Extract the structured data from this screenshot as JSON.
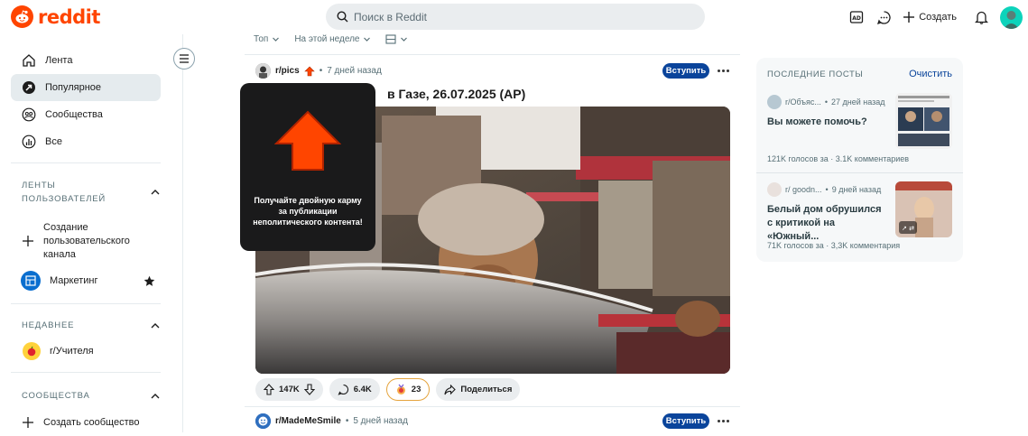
{
  "brand": {
    "name": "reddit",
    "color": "#ff4500"
  },
  "search": {
    "placeholder": "Поиск в Reddit"
  },
  "header": {
    "create_label": "Создать",
    "icons": [
      "ad-icon",
      "chat-icon",
      "plus-icon",
      "bell-icon",
      "avatar"
    ]
  },
  "sidebar": {
    "nav": [
      {
        "label": "Лента",
        "icon": "home-icon"
      },
      {
        "label": "Популярное",
        "icon": "popular-icon",
        "active": true
      },
      {
        "label": "Сообщества",
        "icon": "communities-icon"
      },
      {
        "label": "Все",
        "icon": "all-icon"
      }
    ],
    "custom_feeds": {
      "heading_line1": "ЛЕНТЫ",
      "heading_line2": "ПОЛЬЗОВАТЕЛЕЙ",
      "create_line1": "Создание",
      "create_line2": "пользовательского",
      "create_line3": "канала",
      "marketing": "Маркетинг"
    },
    "recent": {
      "heading": "НЕДАВНЕЕ",
      "item": "r/Учителя"
    },
    "communities": {
      "heading": "СООБЩЕСТВА",
      "create": "Создать сообщество"
    }
  },
  "sort": {
    "sort_label": "Топ",
    "range_label": "На этой неделе"
  },
  "post": {
    "subreddit": "r/pics",
    "time": "7 дней назад",
    "join_label": "Вступить",
    "title_visible": "в Газе, 26.07.2025 (AP)",
    "votes": "147K",
    "comments": "6.4K",
    "awards": "23",
    "share_label": "Поделиться"
  },
  "tooltip": {
    "text": "Получайте двойную карму за публикации неполитического контента!",
    "arrow_color": "#ff4500"
  },
  "post2": {
    "subreddit": "r/MadeMeSmile",
    "time": "5 дней назад",
    "join_label": "Вступить"
  },
  "recent_posts": {
    "title": "ПОСЛЕДНИЕ ПОСТЫ",
    "clear_label": "Очистить",
    "items": [
      {
        "subreddit": "r/Объяс...",
        "time": "27 дней назад",
        "title": "Вы можете помочь?",
        "votes": "121K голосов за",
        "comments": "3.1K комментариев"
      },
      {
        "subreddit": "r/ goodn...",
        "time": "9 дней назад",
        "title": "Белый дом обрушился с критикой на «Южный...",
        "votes": "71K голосов за",
        "comments": "3,3K комментария"
      }
    ]
  }
}
